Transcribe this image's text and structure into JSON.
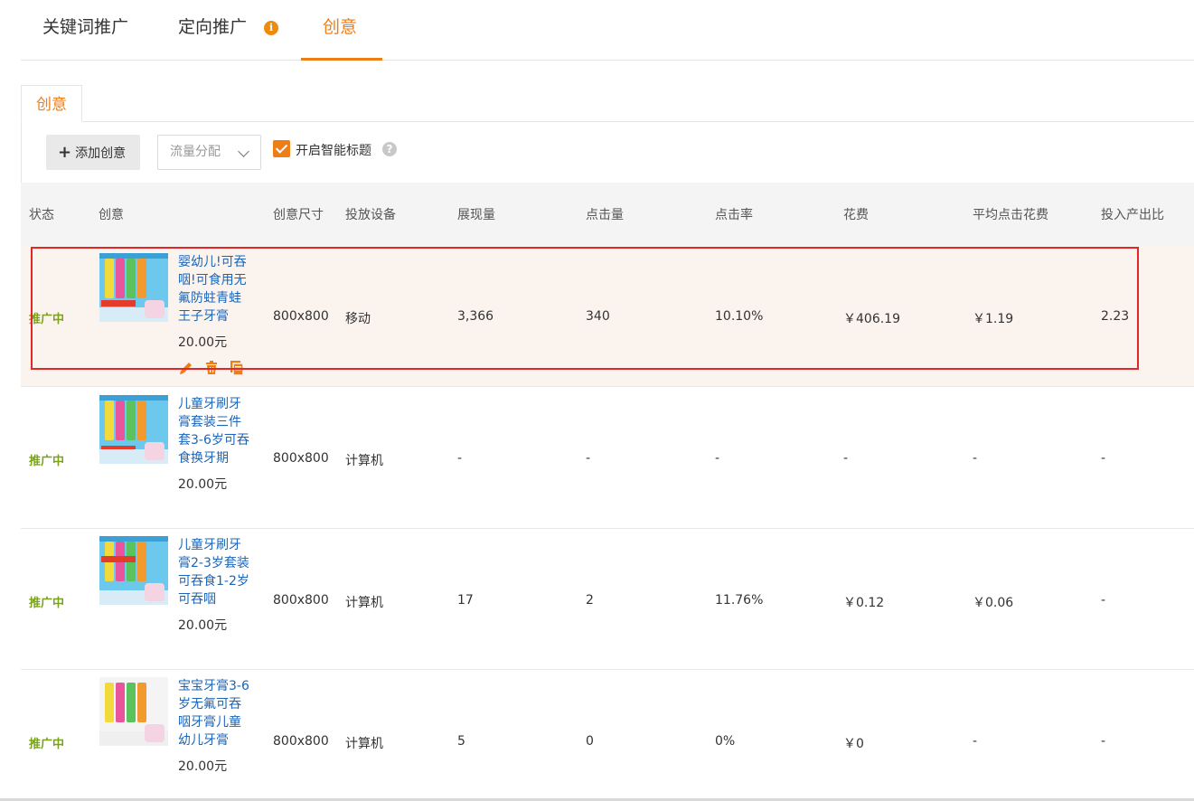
{
  "top_tabs": [
    "关键词推广",
    "定向推广",
    "创意"
  ],
  "active_top_tab": "创意",
  "info_icon": "info-icon",
  "sub_tab": "创意",
  "toolbar": {
    "add_label": "添加创意",
    "flow_select_value": "流量分配",
    "smart_title_label": "开启智能标题",
    "smart_title_checked": true
  },
  "columns": [
    "状态",
    "创意",
    "创意尺寸",
    "投放设备",
    "展现量",
    "点击量",
    "点击率",
    "花费",
    "平均点击花费",
    "投入产出比"
  ],
  "rows": [
    {
      "status": "推广中",
      "title_lines": [
        "婴幼儿!可吞",
        "咽!可食用无",
        "氟防蛀青蛙",
        "王子牙膏"
      ],
      "price": "20.00元",
      "size": "800x800",
      "device": "移动",
      "impressions": "3,366",
      "clicks": "340",
      "ctr": "10.10%",
      "cost": "￥406.19",
      "avg_cpc": "￥1.19",
      "roi": "2.23",
      "thumb_style": "blue",
      "highlighted": true
    },
    {
      "status": "推广中",
      "title_lines": [
        "儿童牙刷牙",
        "膏套装三件",
        "套3-6岁可吞",
        "食换牙期"
      ],
      "price": "20.00元",
      "size": "800x800",
      "device": "计算机",
      "impressions": "-",
      "clicks": "-",
      "ctr": "-",
      "cost": "-",
      "avg_cpc": "-",
      "roi": "-",
      "thumb_style": "blue",
      "highlighted": false
    },
    {
      "status": "推广中",
      "title_lines": [
        "儿童牙刷牙",
        "膏2-3岁套装",
        "可吞食1-2岁",
        "可吞咽"
      ],
      "price": "20.00元",
      "size": "800x800",
      "device": "计算机",
      "impressions": "17",
      "clicks": "2",
      "ctr": "11.76%",
      "cost": "￥0.12",
      "avg_cpc": "￥0.06",
      "roi": "-",
      "thumb_style": "blue",
      "highlighted": false
    },
    {
      "status": "推广中",
      "title_lines": [
        "宝宝牙膏3-6",
        "岁无氟可吞",
        "咽牙膏儿童",
        "幼儿牙膏"
      ],
      "price": "20.00元",
      "size": "800x800",
      "device": "计算机",
      "impressions": "5",
      "clicks": "0",
      "ctr": "0%",
      "cost": "￥0",
      "avg_cpc": "-",
      "roi": "-",
      "thumb_style": "light",
      "highlighted": false
    }
  ],
  "row_actions": [
    "edit-icon",
    "delete-icon",
    "copy-icon"
  ],
  "colors": {
    "accent": "#ee7d14",
    "link": "#1b65b9",
    "status_active": "#7aa31b",
    "highlight_border": "#e2262a",
    "highlight_row": "#fbf3ee"
  }
}
